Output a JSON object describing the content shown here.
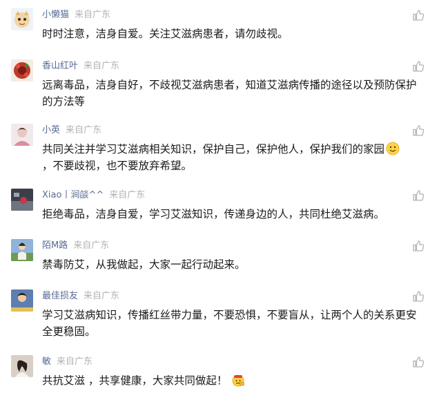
{
  "comments": [
    {
      "nickname": "小懒猫",
      "region": "来自广东",
      "text": "时时注意，洁身自爱。关注艾滋病患者，请勿歧视。",
      "avatar_icon": "cartoon-cat-avatar",
      "avatar_color": "#f2d6a2"
    },
    {
      "nickname": "香山红叶",
      "region": "来自广东",
      "text": "远离毒品，洁身自好，不歧视艾滋病患者，知道艾滋病传播的途径以及预防保护的方法等",
      "avatar_icon": "red-flower-avatar",
      "avatar_color": "#c0392b"
    },
    {
      "nickname": "小英",
      "region": "来自广东",
      "text": "共同关注并学习艾滋病相关知识，保护自己，保护他人，保护我们的家园",
      "text_after": "，不要歧视，也不要放弃希望。",
      "emoji": "smile-emoji",
      "avatar_icon": "portrait-avatar",
      "avatar_color": "#e8c9c2"
    },
    {
      "nickname": "Xiao丨涧燄^^",
      "region": "来自广东",
      "text": "拒绝毒品，洁身自爱，学习艾滋知识，传递身边的人，共同杜绝艾滋病。",
      "avatar_icon": "dark-photo-avatar",
      "avatar_color": "#3c3f47"
    },
    {
      "nickname": "陌M路",
      "region": "来自广东",
      "text": "禁毒防艾，从我做起，大家一起行动起来。",
      "avatar_icon": "outdoor-person-avatar",
      "avatar_color": "#8fb3d9"
    },
    {
      "nickname": "最佳损友",
      "region": "来自广东",
      "text": "学习艾滋病知识，传播红丝带力量，不要恐惧，不要盲从，让两个人的关系更安全更稳固。",
      "avatar_icon": "child-photo-avatar",
      "avatar_color": "#5d7fb0"
    },
    {
      "nickname": "敏",
      "region": "来自广东",
      "text": "共抗艾滋 ，共享健康，大家共同做起！",
      "emoji": "fist-emoji",
      "avatar_icon": "woman-photo-avatar",
      "avatar_color": "#d9d0c5"
    }
  ],
  "colors": {
    "nickname": "#576b95",
    "region": "#b2b2b2",
    "text": "#1a1a1a",
    "like_icon": "#b2b2b2"
  }
}
